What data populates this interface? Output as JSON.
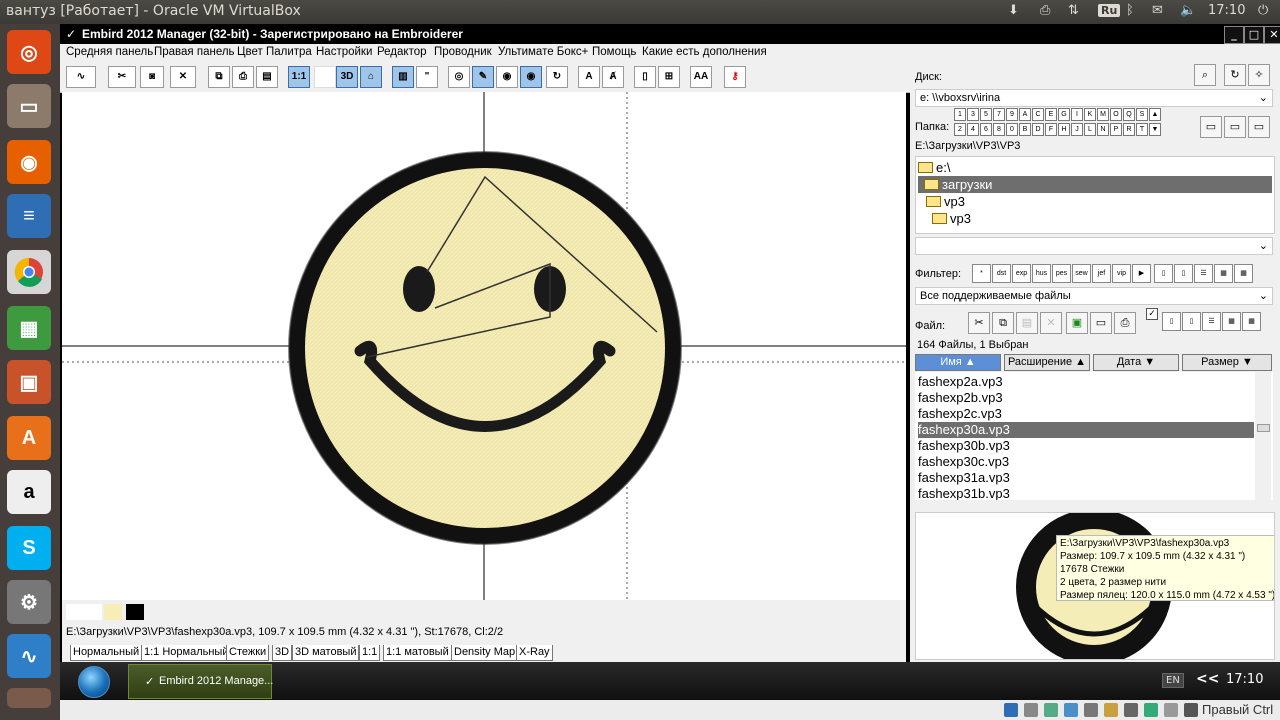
{
  "topbar": {
    "title": "вантуз [Работает] - Oracle VM VirtualBox",
    "lang": "Ru",
    "clock": "17:10"
  },
  "window": {
    "title": "Embird 2012 Manager (32-bit) - Зарегистрировано на Embroiderer"
  },
  "menu": [
    "Средняя панель",
    "Правая панель",
    "Цвет Палитра",
    "Настройки",
    "Редактор",
    "Проводник",
    "Ультимате Бокс+",
    "Помощь",
    "Какие есть дополнения"
  ],
  "toolbar": {
    "btn_1to1": "1:1",
    "btn_3d": "3D",
    "btn_text_a": "A",
    "btn_text_aa": "AA"
  },
  "right": {
    "disk_label": "Диск:",
    "disk_value": "e: \\\\vboxsrv\\irina",
    "folder_label": "Папка:",
    "folder_keys_top": [
      "1",
      "3",
      "5",
      "7",
      "9",
      "A",
      "C",
      "E",
      "G",
      "I",
      "K",
      "M",
      "O",
      "Q",
      "S"
    ],
    "folder_keys_bottom": [
      "2",
      "4",
      "6",
      "8",
      "0",
      "B",
      "D",
      "F",
      "H",
      "J",
      "L",
      "N",
      "P",
      "R",
      "T"
    ],
    "path": "E:\\Загрузки\\VP3\\VP3",
    "tree": [
      "e:\\",
      "загрузки",
      "vp3",
      "vp3"
    ],
    "filter_label": "Фильтер:",
    "filter_buttons": [
      "*",
      "dst",
      "exp",
      "hus",
      "pes",
      "sew",
      "jef",
      "vip"
    ],
    "filter_value": "Все поддерживаемые файлы",
    "file_label": "Файл:",
    "file_count": "164 Файлы, 1 Выбран",
    "columns": [
      "Имя ▲",
      "Расширение ▲",
      "Дата ▼",
      "Размер ▼"
    ],
    "files": [
      "fashexp2a.vp3",
      "fashexp2b.vp3",
      "fashexp2c.vp3",
      "fashexp30a.vp3",
      "fashexp30b.vp3",
      "fashexp30c.vp3",
      "fashexp31a.vp3",
      "fashexp31b.vp3"
    ],
    "tooltip": [
      "E:\\Загрузки\\VP3\\VP3\\fashexp30a.vp3",
      "Размер: 109.7 x 109.5 mm (4.32 x 4.31 \")",
      "17678 Стежки",
      "2 цвета, 2 размер нити",
      "Размер пялец: 120.0 x 115.0 mm (4.72 x 4.53 \")"
    ]
  },
  "status_text": "E:\\Загрузки\\VP3\\VP3\\fashexp30a.vp3, 109.7 x 109.5 mm (4.32 x 4.31 \"), St:17678, Cl:2/2",
  "palette_colors": [
    "#ffffff",
    "#f6eeb4",
    "#000000"
  ],
  "view_tabs": [
    "Нормальный",
    "1:1 Нормальный",
    "Стежки",
    "3D",
    "3D матовый",
    "1:1",
    "1:1 матовый",
    "Density Map",
    "X-Ray"
  ],
  "taskbar": {
    "task_label": "Embird 2012 Manage...",
    "lang": "EN",
    "clock": "17:10",
    "chevron": "<<"
  },
  "vbox_status": {
    "hostkey": "Правый Ctrl"
  }
}
